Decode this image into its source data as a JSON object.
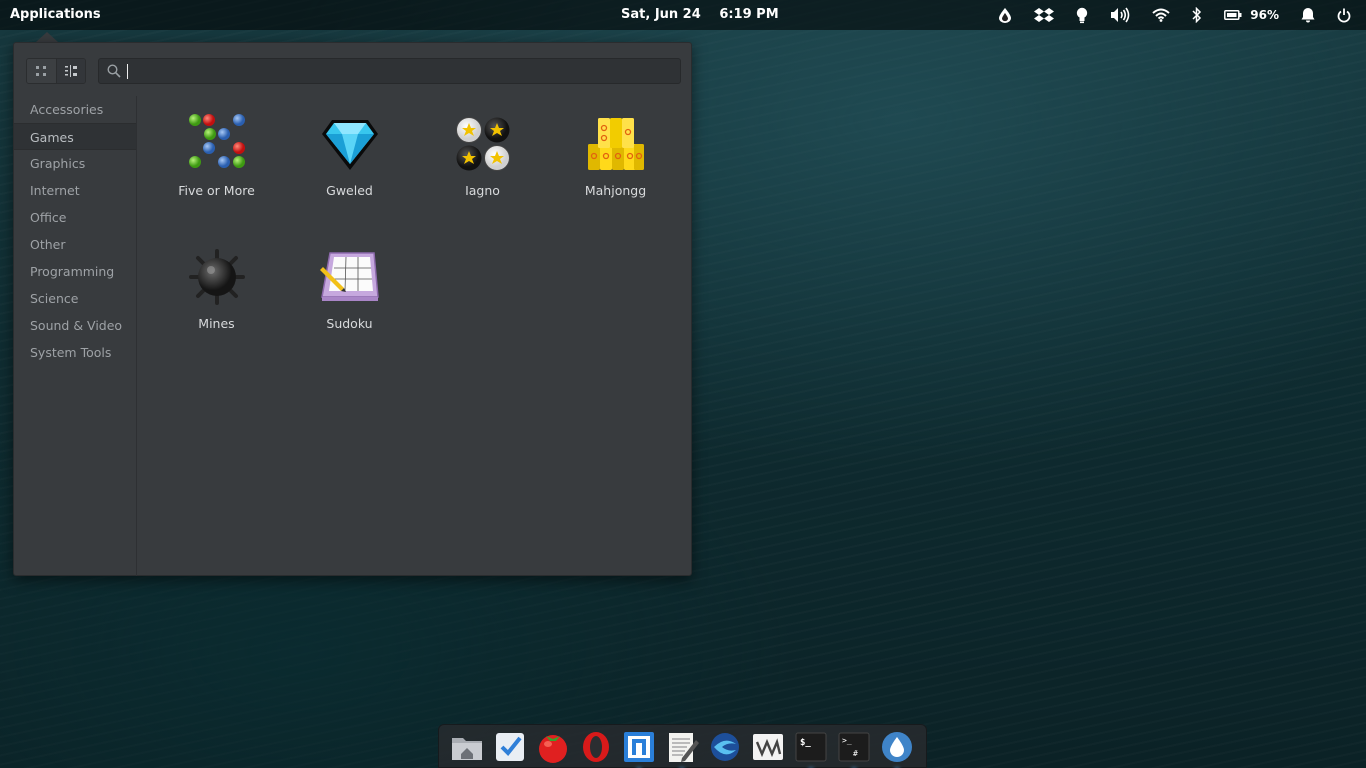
{
  "panel": {
    "applications_label": "Applications",
    "date": "Sat, Jun 24",
    "time": "6:19 PM",
    "battery_percent": "96%",
    "indicators": [
      "droplet-icon",
      "dropbox-icon",
      "lightbulb-icon",
      "volume-icon",
      "wifi-icon",
      "bluetooth-icon",
      "battery-icon",
      "notification-bell-icon",
      "power-icon"
    ]
  },
  "menu": {
    "search": {
      "value": "",
      "placeholder": ""
    },
    "view_modes": [
      "grid-view-icon",
      "category-view-icon"
    ],
    "categories": [
      {
        "label": "Accessories",
        "selected": false
      },
      {
        "label": "Games",
        "selected": true
      },
      {
        "label": "Graphics",
        "selected": false
      },
      {
        "label": "Internet",
        "selected": false
      },
      {
        "label": "Office",
        "selected": false
      },
      {
        "label": "Other",
        "selected": false
      },
      {
        "label": "Programming",
        "selected": false
      },
      {
        "label": "Science",
        "selected": false
      },
      {
        "label": "Sound & Video",
        "selected": false
      },
      {
        "label": "System Tools",
        "selected": false
      }
    ],
    "apps": [
      {
        "label": "Five or More",
        "icon": "five-or-more-icon"
      },
      {
        "label": "Gweled",
        "icon": "gweled-gem-icon"
      },
      {
        "label": "Iagno",
        "icon": "iagno-icon"
      },
      {
        "label": "Mahjongg",
        "icon": "mahjongg-icon"
      },
      {
        "label": "Mines",
        "icon": "mines-icon"
      },
      {
        "label": "Sudoku",
        "icon": "sudoku-icon"
      }
    ]
  },
  "dock": {
    "items": [
      {
        "icon": "files-icon",
        "running": false
      },
      {
        "icon": "tasks-icon",
        "running": false
      },
      {
        "icon": "tomato-timer-icon",
        "running": false
      },
      {
        "icon": "opera-icon",
        "running": false
      },
      {
        "icon": "code-editor-icon",
        "running": true
      },
      {
        "icon": "text-editor-icon",
        "running": true
      },
      {
        "icon": "web-browser-icon",
        "running": false
      },
      {
        "icon": "vm-icon",
        "running": false
      },
      {
        "icon": "terminal-icon",
        "running": true
      },
      {
        "icon": "root-terminal-icon",
        "running": true
      },
      {
        "icon": "droplet-app-icon",
        "running": true
      }
    ]
  },
  "colors": {
    "panel_bg": "#000000",
    "menu_bg": "#383b3e",
    "running_indicator": "#5cb6ff"
  }
}
